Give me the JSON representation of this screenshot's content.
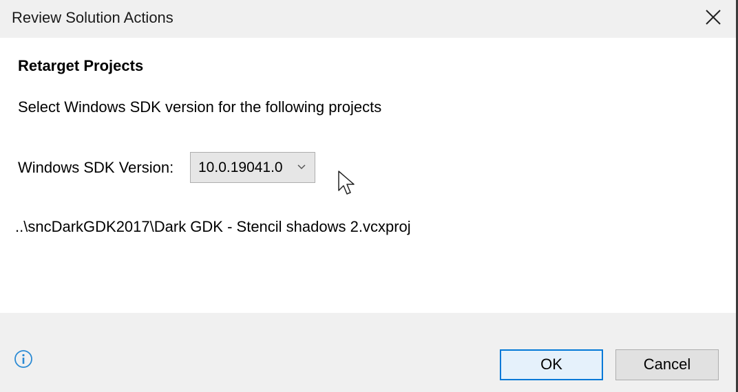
{
  "window": {
    "title": "Review Solution Actions",
    "close_icon": "close-icon"
  },
  "content": {
    "heading": "Retarget Projects",
    "description": "Select Windows SDK version for the following projects",
    "sdk_label": "Windows SDK Version:",
    "sdk_selected": "10.0.19041.0",
    "project_path": "..\\sncDarkGDK2017\\Dark GDK - Stencil shadows 2.vcxproj"
  },
  "footer": {
    "info_icon": "info-icon",
    "ok_label": "OK",
    "cancel_label": "Cancel"
  },
  "colors": {
    "accent": "#0078d7",
    "background": "#f0f0f0",
    "content_background": "#ffffff",
    "info_icon": "#2a8ad4"
  }
}
